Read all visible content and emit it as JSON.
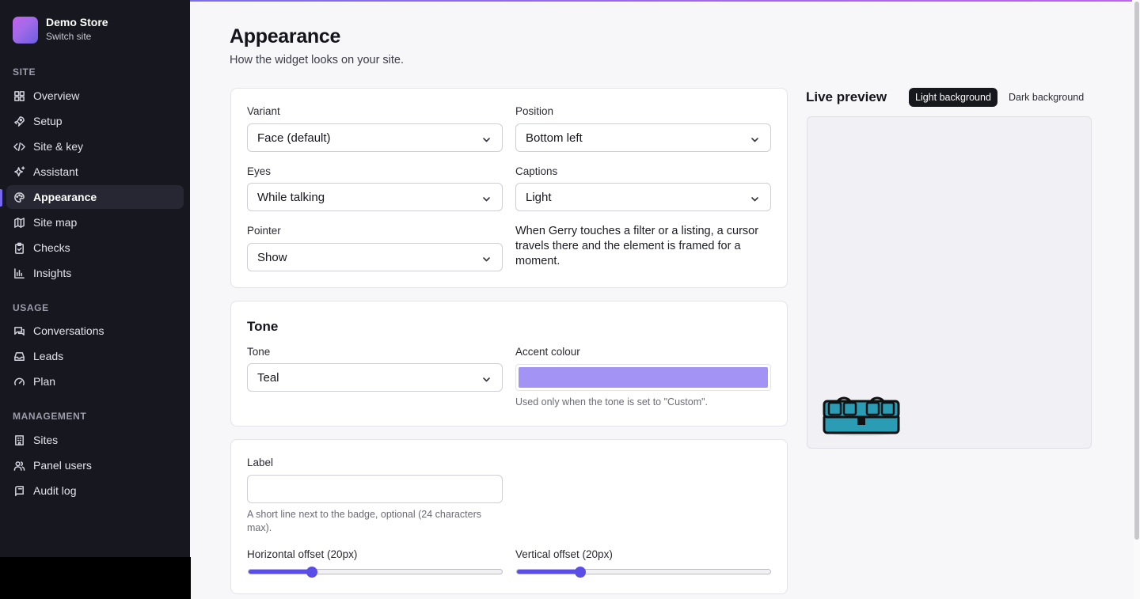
{
  "store": {
    "name": "Demo Store",
    "switch_label": "Switch site"
  },
  "sidebar": {
    "sections": [
      {
        "title": "SITE",
        "items": [
          {
            "label": "Overview",
            "icon": "grid-icon"
          },
          {
            "label": "Setup",
            "icon": "rocket-icon"
          },
          {
            "label": "Site & key",
            "icon": "code-icon"
          },
          {
            "label": "Assistant",
            "icon": "sparkles-icon"
          },
          {
            "label": "Appearance",
            "icon": "palette-icon",
            "active": true
          },
          {
            "label": "Site map",
            "icon": "map-icon"
          },
          {
            "label": "Checks",
            "icon": "clipboard-check-icon"
          },
          {
            "label": "Insights",
            "icon": "bar-chart-icon"
          }
        ]
      },
      {
        "title": "USAGE",
        "items": [
          {
            "label": "Conversations",
            "icon": "chat-icon"
          },
          {
            "label": "Leads",
            "icon": "inbox-icon"
          },
          {
            "label": "Plan",
            "icon": "gauge-icon"
          }
        ]
      },
      {
        "title": "MANAGEMENT",
        "items": [
          {
            "label": "Sites",
            "icon": "building-icon"
          },
          {
            "label": "Panel users",
            "icon": "users-icon"
          },
          {
            "label": "Audit log",
            "icon": "log-icon"
          }
        ]
      }
    ]
  },
  "page": {
    "title": "Appearance",
    "subtitle": "How the widget looks on your site."
  },
  "widget_card": {
    "variant": {
      "label": "Variant",
      "value": "Face (default)"
    },
    "position": {
      "label": "Position",
      "value": "Bottom left"
    },
    "eyes": {
      "label": "Eyes",
      "value": "While talking"
    },
    "captions": {
      "label": "Captions",
      "value": "Light"
    },
    "pointer": {
      "label": "Pointer",
      "value": "Show"
    },
    "pointer_help": "When Gerry touches a filter or a listing, a cursor travels there and the element is framed for a moment."
  },
  "tone_card": {
    "title": "Tone",
    "tone": {
      "label": "Tone",
      "value": "Teal"
    },
    "accent": {
      "label": "Accent colour",
      "color": "#a393f5",
      "help": "Used only when the tone is set to \"Custom\"."
    }
  },
  "label_card": {
    "label": {
      "label": "Label",
      "value": "",
      "help": "A short line next to the badge, optional (24 characters max)."
    },
    "h_offset": {
      "label": "Horizontal offset (20px)",
      "value": 20,
      "min": 0,
      "max": 80
    },
    "v_offset": {
      "label": "Vertical offset (20px)",
      "value": 20,
      "min": 0,
      "max": 80
    }
  },
  "preview": {
    "title": "Live preview",
    "tabs": [
      {
        "label": "Light background",
        "active": true
      },
      {
        "label": "Dark background",
        "active": false
      }
    ],
    "badge_icon": "teal-face-badge-icon"
  },
  "colors": {
    "accent": "#5b4ee6",
    "sidebar_bg": "#16171f",
    "badge_teal": "#2a9db5"
  }
}
